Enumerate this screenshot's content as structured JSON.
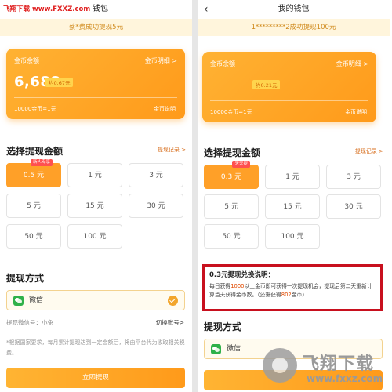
{
  "left": {
    "watermark_site": "飞翔下载 www.FXXZ.com",
    "title_fragment": "钱包",
    "notice": "蔡*费成功提现5元",
    "coin_card": {
      "label": "金币余额",
      "detail_link": "金币明细 >",
      "amount": "6,688",
      "approx": "约0.67元",
      "rate": "10000金币=1元",
      "explain_link": "金币说明"
    },
    "amount_section": {
      "title": "选择提现金额",
      "records_link": "提现记录 >"
    },
    "amounts": [
      {
        "label": "0.5 元",
        "badge": "新人专享"
      },
      {
        "label": "1 元"
      },
      {
        "label": "3 元"
      },
      {
        "label": "5 元"
      },
      {
        "label": "15 元"
      },
      {
        "label": "30 元"
      },
      {
        "label": "50 元"
      },
      {
        "label": "100 元"
      }
    ],
    "method": {
      "title": "提现方式",
      "wechat": "微信",
      "account_label": "提现微信号：小兔",
      "switch_link": "切换账号>"
    },
    "footnote": "*根据国家要求，每月累计提现达到一定金额后，将由平台代为收取相关税费。",
    "submit": "立即提现"
  },
  "right": {
    "title": "我的钱包",
    "notice": "1*********2成功提现100元",
    "coin_card": {
      "label": "金币余额",
      "detail_link": "金币明细 >",
      "approx": "约0.21元",
      "rate": "10000金币=1元",
      "explain_link": "金币说明"
    },
    "amount_section": {
      "title": "选择提现金额",
      "records_link": "提现记录 >"
    },
    "amounts": [
      {
        "label": "0.3 元",
        "badge": "天天提"
      },
      {
        "label": "1 元"
      },
      {
        "label": "3 元"
      },
      {
        "label": "5 元"
      },
      {
        "label": "15 元"
      },
      {
        "label": "30 元"
      },
      {
        "label": "50 元"
      },
      {
        "label": "100 元"
      }
    ],
    "explain": {
      "title": "0.3元提现兑换说明：",
      "t1": "每日获得",
      "h1": "1000",
      "t2": "以上金币即可获得一次提现机会，提现后第二天重新计算当天获得金币数。（还需获得",
      "h2": "802",
      "t3": "金币）"
    },
    "method": {
      "title": "提现方式",
      "wechat": "微信"
    },
    "watermark": {
      "text": "飞翔下载",
      "url": "www.fxxz.com"
    }
  },
  "colors": {
    "accent": "#ff9a1a",
    "highlight_border": "#c8101e",
    "link": "#d87020"
  }
}
